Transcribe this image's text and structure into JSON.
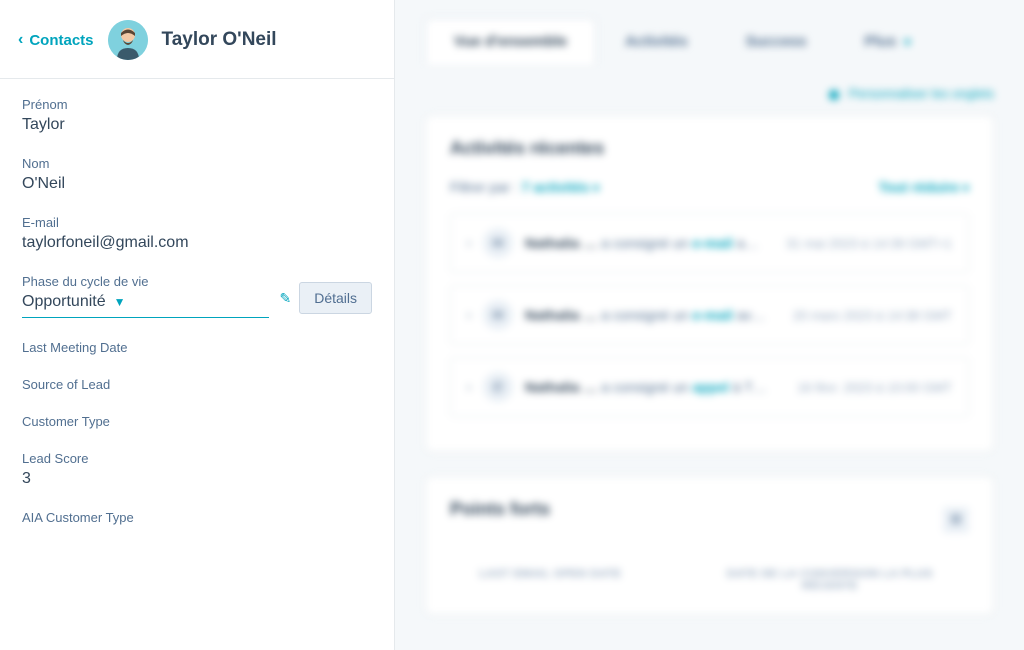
{
  "sidebar": {
    "back_label": "Contacts",
    "contact_name": "Taylor O'Neil",
    "fields": {
      "first_name": {
        "label": "Prénom",
        "value": "Taylor"
      },
      "last_name": {
        "label": "Nom",
        "value": "O'Neil"
      },
      "email": {
        "label": "E-mail",
        "value": "taylorfoneil@gmail.com"
      },
      "lifecycle": {
        "label": "Phase du cycle de vie",
        "value": "Opportunité",
        "details_btn": "Détails"
      },
      "last_meeting": {
        "label": "Last Meeting Date",
        "value": ""
      },
      "lead_source": {
        "label": "Source of Lead",
        "value": ""
      },
      "customer_type": {
        "label": "Customer Type",
        "value": ""
      },
      "lead_score": {
        "label": "Lead Score",
        "value": "3"
      },
      "aia_customer_type": {
        "label": "AIA Customer Type",
        "value": ""
      }
    }
  },
  "main": {
    "tabs": {
      "overview": "Vue d'ensemble",
      "activities": "Activités",
      "success": "Success",
      "more": "Plus"
    },
    "customize_link": "Personnaliser les onglets",
    "recent_activities": {
      "title": "Activités récentes",
      "filter_label": "Filtrer par :",
      "filter_value": "7 activités",
      "collapse_all": "Tout réduire",
      "items": [
        {
          "actor": "Nathalia …",
          "verb": "a consigné un",
          "type": "e-mail",
          "suffix": "a…",
          "date": "31 mai 2023 à 14:39 GMT+1"
        },
        {
          "actor": "Nathalia …",
          "verb": "a consigné un",
          "type": "e-mail",
          "suffix": "av…",
          "date": "20 mars 2023 à 14:38 GMT"
        },
        {
          "actor": "Nathalia …",
          "verb": "a consigné un",
          "type": "appel",
          "suffix": "à T…",
          "date": "16 févr. 2023 à 10:00 GMT"
        }
      ]
    },
    "highlights": {
      "title": "Points forts",
      "col1": "LAST EMAIL OPEN DATE",
      "col2": "DATE DE LA CONVERSION LA PLUS RÉCENTE"
    }
  }
}
